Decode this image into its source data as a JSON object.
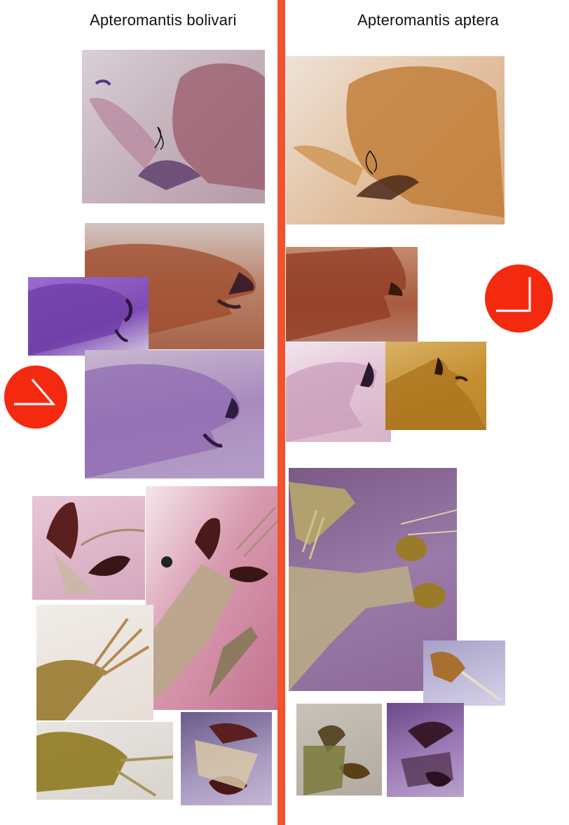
{
  "left_title": "Apteromantis bolivari",
  "right_title": "Apteromantis aptera",
  "colors": {
    "divider": "#f2522e",
    "badge": "#f42a10",
    "stain_orange": "#c9863a",
    "stain_purple": "#8a5bb0"
  }
}
